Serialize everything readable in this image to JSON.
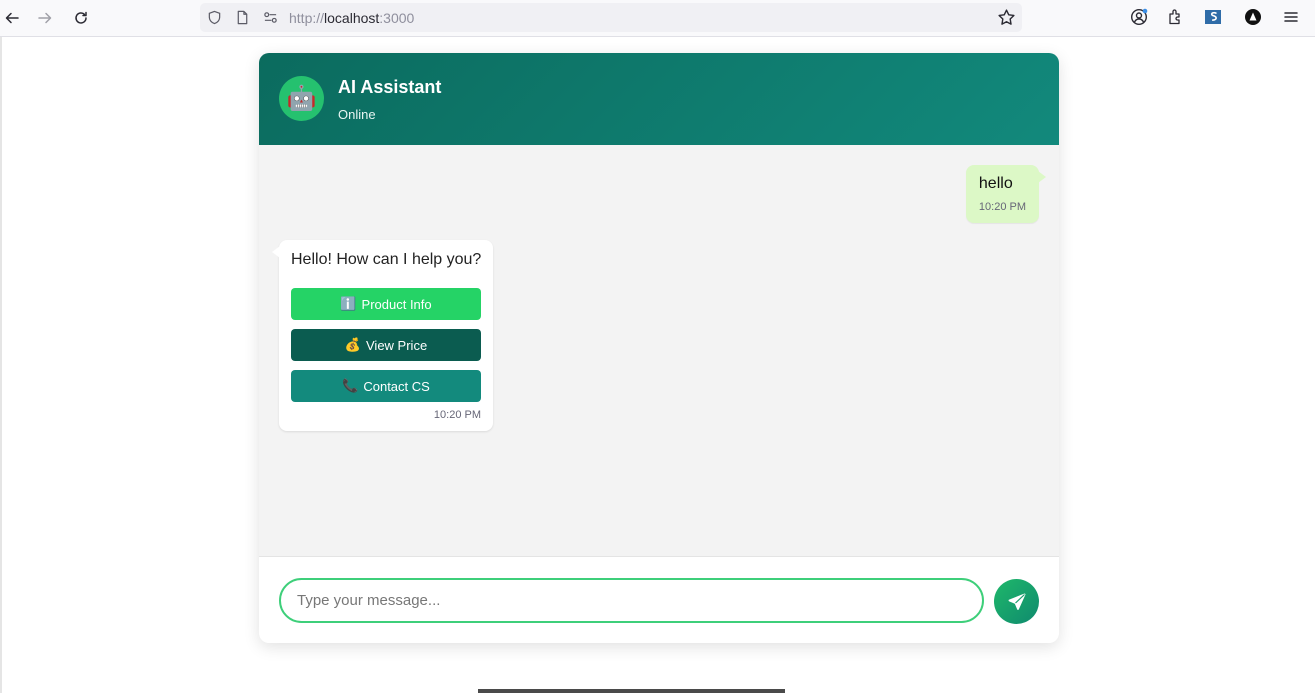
{
  "browser": {
    "url_prefix": "http://",
    "url_host": "localhost",
    "url_port": ":3000"
  },
  "chat": {
    "header": {
      "avatar_emoji": "🤖",
      "title": "AI Assistant",
      "status": "Online"
    },
    "messages": [
      {
        "sender": "user",
        "text": "hello",
        "time": "10:20 PM"
      },
      {
        "sender": "bot",
        "text": "Hello! How can I help you?",
        "time": "10:20 PM"
      }
    ],
    "quick_replies": [
      {
        "icon": "ℹ️",
        "label": "Product Info",
        "color": "#25d366"
      },
      {
        "icon": "💰",
        "label": "View Price",
        "color": "#0b5c50"
      },
      {
        "icon": "📞",
        "label": "Contact CS",
        "color": "#138a7d"
      }
    ],
    "input": {
      "placeholder": "Type your message...",
      "value": ""
    }
  }
}
